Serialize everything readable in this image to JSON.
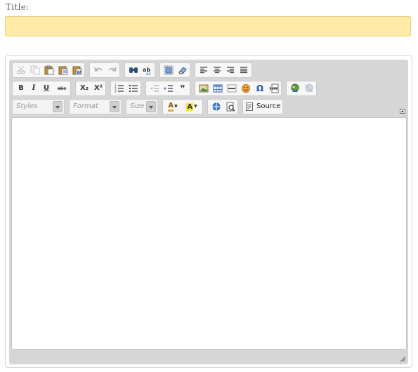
{
  "form": {
    "title_label": "Title:",
    "title_value": "",
    "title_background": "#ffeaa6"
  },
  "editor": {
    "toolbar": {
      "row1": [
        {
          "name": "cut-icon",
          "enabled": false
        },
        {
          "name": "copy-icon",
          "enabled": false
        },
        {
          "name": "paste-icon",
          "enabled": true
        },
        {
          "name": "paste-text-icon",
          "enabled": true
        },
        {
          "name": "paste-word-icon",
          "enabled": true
        },
        {
          "name": "undo-icon",
          "enabled": false
        },
        {
          "name": "redo-icon",
          "enabled": false
        },
        {
          "name": "find-icon",
          "enabled": true
        },
        {
          "name": "replace-icon",
          "enabled": true
        },
        {
          "name": "select-all-icon",
          "enabled": true
        },
        {
          "name": "remove-format-icon",
          "enabled": true
        },
        {
          "name": "align-left-icon",
          "enabled": true
        },
        {
          "name": "align-center-icon",
          "enabled": true
        },
        {
          "name": "align-right-icon",
          "enabled": true
        },
        {
          "name": "justify-icon",
          "enabled": true
        }
      ],
      "bold_label": "B",
      "italic_label": "I",
      "underline_label": "U",
      "strike_label": "abc",
      "subscript_label": "X₂",
      "superscript_label": "X²",
      "blockquote_label": "❞",
      "special_char_label": "Ω",
      "styles_placeholder": "Styles",
      "format_placeholder": "Format",
      "size_placeholder": "Size",
      "text_color_label": "A",
      "bg_color_label": "A",
      "source_label": "Source"
    },
    "accent_colors": {
      "toolbar_bg": "#d6d6d6",
      "text_color_swatch": "#f0a22e",
      "bg_color_swatch": "#f4e92a"
    }
  }
}
